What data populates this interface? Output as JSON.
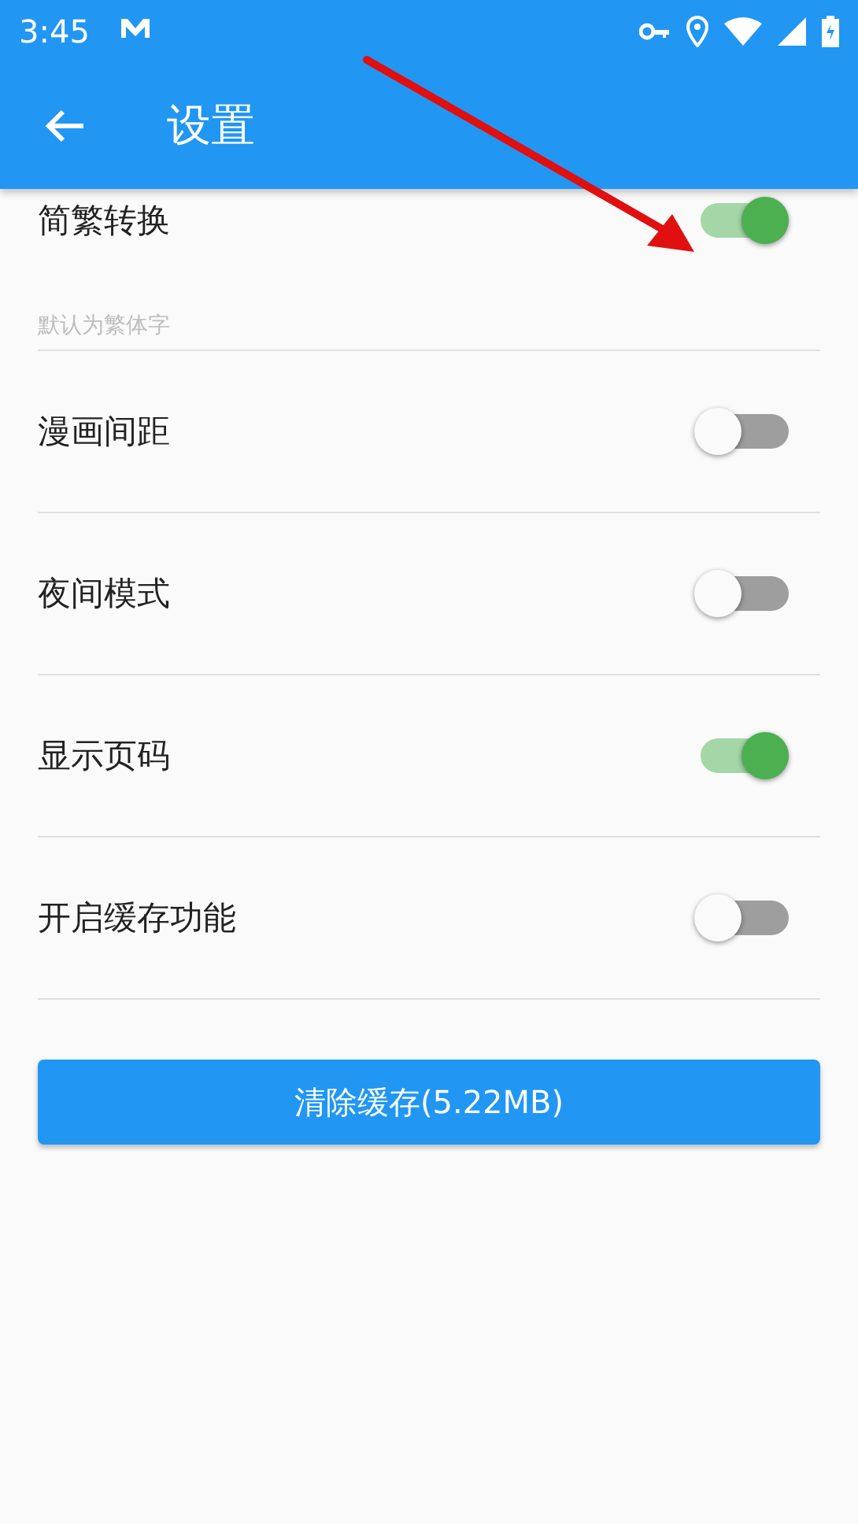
{
  "status_bar": {
    "time": "3:45"
  },
  "app_bar": {
    "title": "设置"
  },
  "settings": [
    {
      "label": "简繁转换",
      "subtitle": "默认为繁体字",
      "on": true
    },
    {
      "label": "漫画间距",
      "on": false
    },
    {
      "label": "夜间模式",
      "on": false
    },
    {
      "label": "显示页码",
      "on": true
    },
    {
      "label": "开启缓存功能",
      "on": false
    }
  ],
  "clear_cache_button": {
    "label": "清除缓存(5.22MB)"
  }
}
